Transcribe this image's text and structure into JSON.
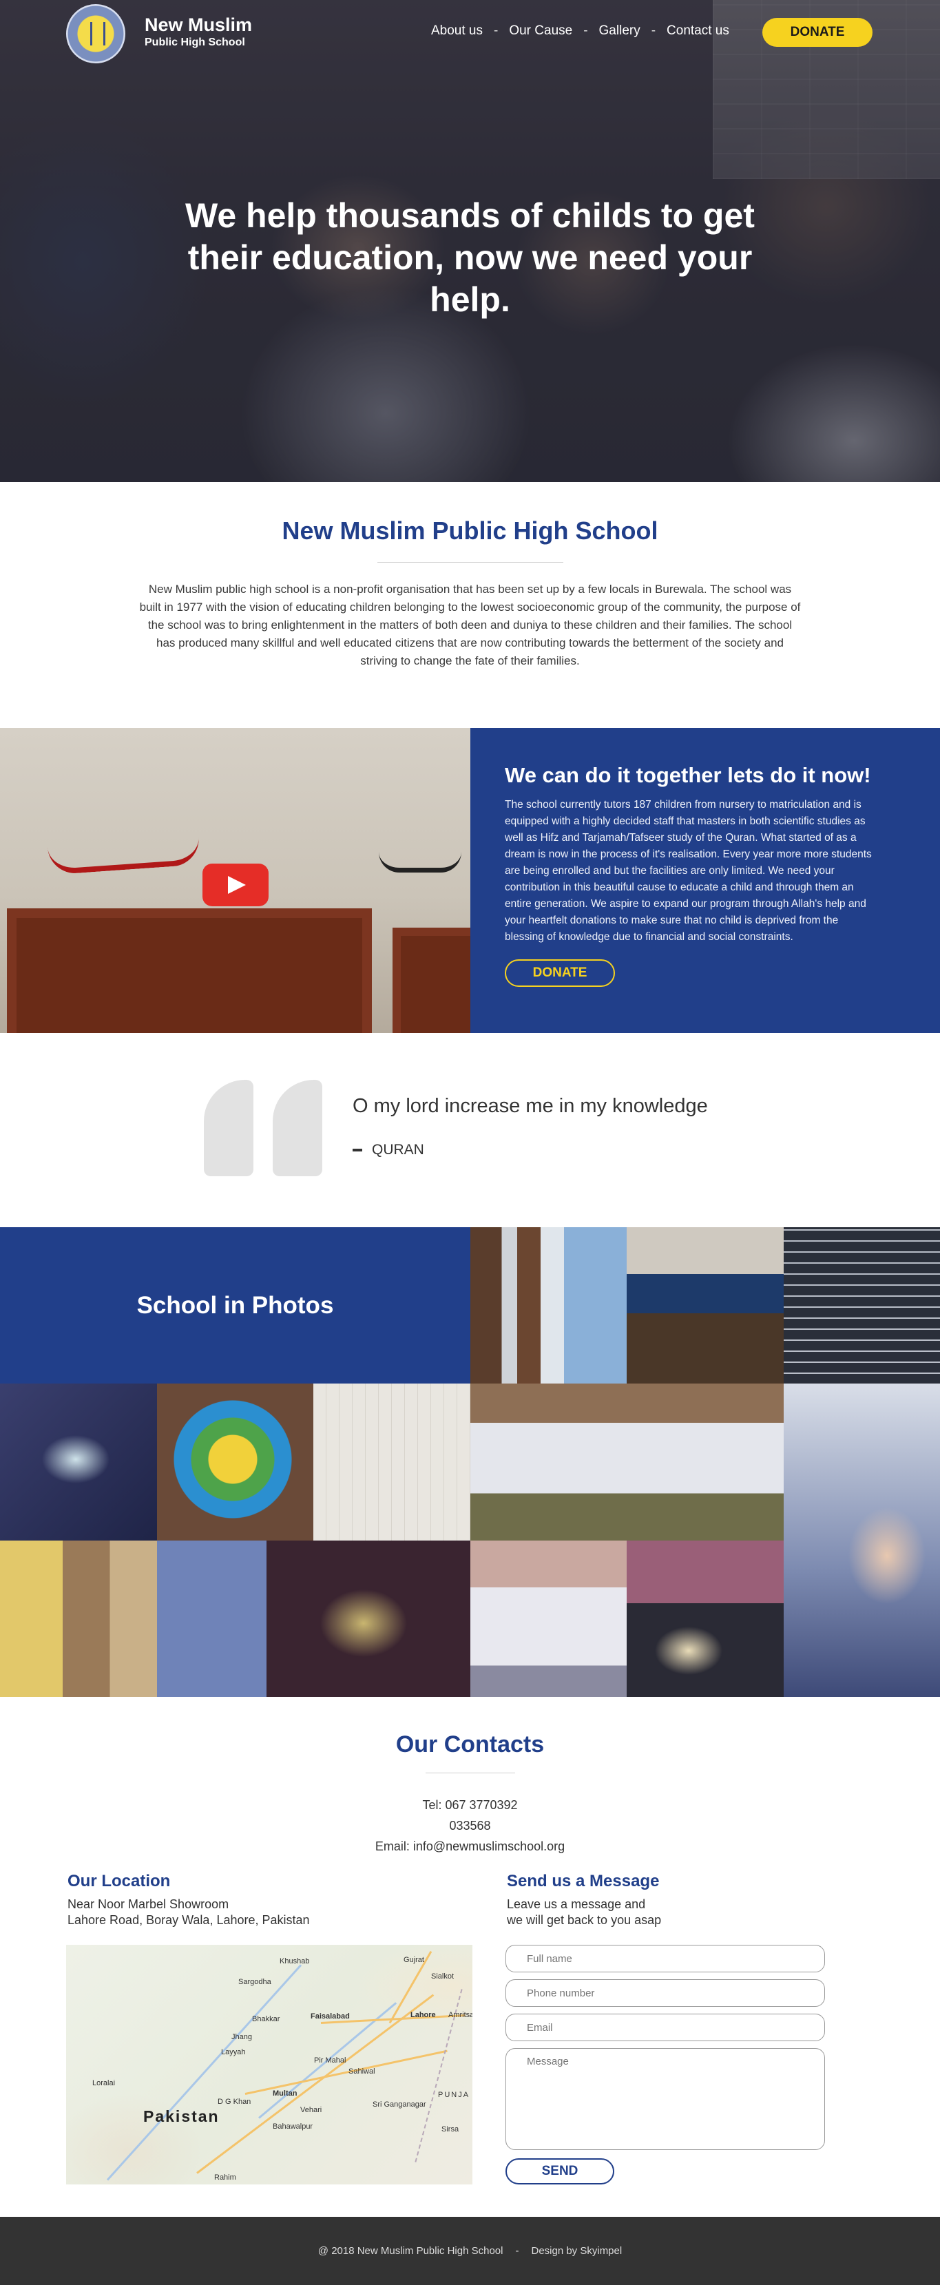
{
  "header": {
    "brand_line1": "New Muslim",
    "brand_line2": "Public High School",
    "nav": [
      "About us",
      "Our Cause",
      "Gallery",
      "Contact us"
    ],
    "nav_separator": "-",
    "donate_label": "DONATE"
  },
  "hero": {
    "title": "We help thousands of childs to get their education, now we need your help."
  },
  "intro": {
    "title": "New Muslim Public High School",
    "text": "New Muslim public high school is a non-profit organisation that has been set up by a few locals in Burewala. The school was built in 1977 with the vision of educating children belonging to the lowest socioeconomic group of the community, the purpose of the school was to bring enlightenment in the matters of both deen and duniya to these children and their families. The school has produced many skillful and well educated citizens that are now contributing towards the betterment of the society and striving to change the fate of their families."
  },
  "cause": {
    "title": "We can do it together lets do it now!",
    "text": "The school currently tutors 187 children from nursery to matriculation and is equipped with a highly decided staff that masters in both scientific studies as well as Hifz and Tarjamah/Tafseer study of the Quran. What started of as a dream is now in the process of it's realisation. Every year more more students are being enrolled and but the facilities are only limited. We need your contribution in this beautiful cause to educate a child and through them an entire generation. We aspire to expand our program through Allah's help and your heartfelt donations to make sure that no child is deprived from the blessing of knowledge due to financial and social constraints.",
    "donate_label": "DONATE"
  },
  "quote": {
    "text": "O my lord increase me in my knowledge",
    "source": "QURAN"
  },
  "gallery": {
    "title": "School in Photos"
  },
  "contacts": {
    "title": "Our Contacts",
    "tel": "Tel: 067 3770392",
    "mobile": "033568",
    "email": "Email: info@newmuslimschool.org",
    "location_title": "Our Location",
    "location_line1": "Near Noor Marbel Showroom",
    "location_line2": "Lahore Road, Boray Wala, Lahore, Pakistan",
    "message_title": "Send us a Message",
    "message_line1": "Leave us a message and",
    "message_line2": "we will get back to you asap",
    "form": {
      "name_placeholder": "Full name",
      "phone_placeholder": "Phone number",
      "email_placeholder": "Email",
      "message_placeholder": "Message",
      "send_label": "SEND"
    },
    "map_labels": {
      "country": "Pakistan",
      "cities": [
        "Faisalabad",
        "Lahore",
        "Multan",
        "Sahiwal",
        "Bahawalpur",
        "Jhang",
        "Sargodha",
        "Sialkot",
        "Gujrat",
        "Khushab",
        "Bhakkar",
        "Layyah",
        "Pir Mahal",
        "Vehari",
        "D G Khan",
        "Sri Ganganagar",
        "Amritsar",
        "Loralai",
        "Rahim",
        "Sirsa",
        "PUNJA"
      ]
    }
  },
  "footer": {
    "copyright": "@ 2018 New Muslim Public High School",
    "separator": "-",
    "credit": "Design by Skyimpel"
  },
  "colors": {
    "brand_blue": "#213f8a",
    "accent_yellow": "#f6d21f",
    "footer_bg": "#333333"
  }
}
